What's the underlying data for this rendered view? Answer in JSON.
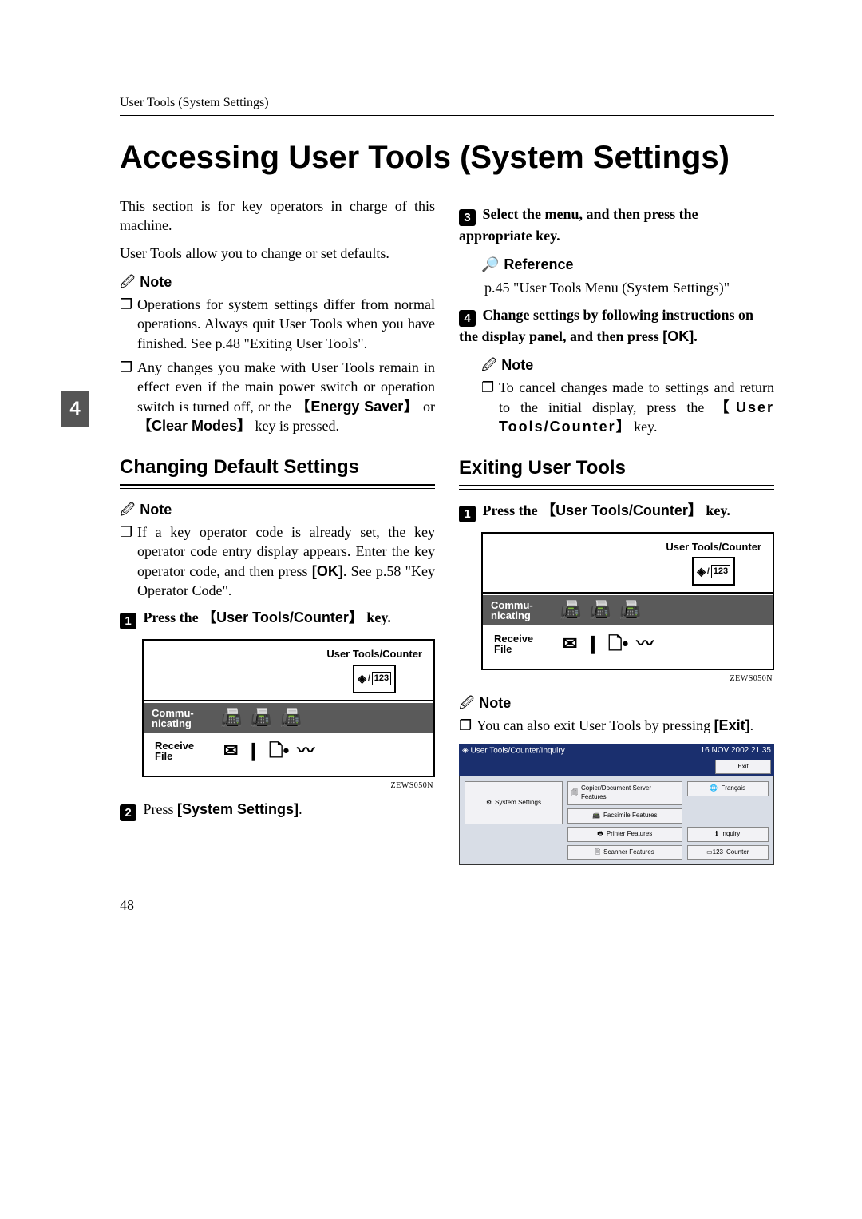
{
  "running_head": "User Tools (System Settings)",
  "side_tab": "4",
  "page_number": "48",
  "title": "Accessing User Tools (System Settings)",
  "left": {
    "intro1": "This section is for key operators in charge of this machine.",
    "intro2": "User Tools allow you to change or set defaults.",
    "note_label": "Note",
    "note_items": {
      "a": "Operations for system settings differ from normal operations. Always quit User Tools when you have finished. See p.48 \"Exiting User Tools\".",
      "b_pre": "Any changes you make with User Tools remain in effect even if the main power switch or operation switch is turned off, or the ",
      "b_key1": "Energy Saver",
      "b_mid": " or ",
      "b_key2": "Clear Modes",
      "b_post": " key is pressed."
    },
    "subhead": "Changing Default Settings",
    "note2_label": "Note",
    "note2_item_pre": "If a key operator code is already set, the key operator code entry display appears. Enter the key operator code, and then press ",
    "note2_item_ok": "[OK]",
    "note2_item_post": ". See p.58 \"Key Operator Code\".",
    "step1_pre": "Press the ",
    "step1_key": "User Tools/Counter",
    "step1_post": " key.",
    "fig_caption": "ZEWS050N",
    "fig": {
      "title": "User Tools/Counter",
      "row1": "Commu-\nnicating",
      "row2": "Receive\nFile"
    },
    "step2_pre": "Press ",
    "step2_key": "[System Settings]",
    "step2_post": "."
  },
  "right": {
    "step3": "Select the menu, and then press the appropriate key.",
    "ref_label": "Reference",
    "ref_text": "p.45 \"User Tools Menu (System Settings)\"",
    "step4_pre": "Change settings by following instructions on the display panel, and then press ",
    "step4_key": "[OK]",
    "step4_post": ".",
    "note_label": "Note",
    "note_item_pre": "To cancel changes made to settings and return to the initial display, press the ",
    "note_item_key": "User Tools/Counter",
    "note_item_post": " key.",
    "subhead": "Exiting User Tools",
    "step1_pre": "Press the ",
    "step1_key": "User Tools/Counter",
    "step1_post": " key.",
    "fig_caption": "ZEWS050N",
    "fig": {
      "title": "User Tools/Counter",
      "row1": "Commu-\nnicating",
      "row2": "Receive\nFile"
    },
    "note2_label": "Note",
    "note2_item_pre": "You can also exit User Tools by pressing ",
    "note2_item_key": "[Exit]",
    "note2_item_post": ".",
    "screen": {
      "bar_left": "User Tools/Counter/Inquiry",
      "bar_right_time": "16 NOV 2002 21:35",
      "bar_exit": "Exit",
      "btn1": "System Settings",
      "btn2": "Copier/Document Server Features",
      "btn3": "Facsimile Features",
      "btn4": "Printer Features",
      "btn5": "Scanner Features",
      "btn6": "Français",
      "btn7": "Inquiry",
      "btn8": "Counter"
    }
  }
}
